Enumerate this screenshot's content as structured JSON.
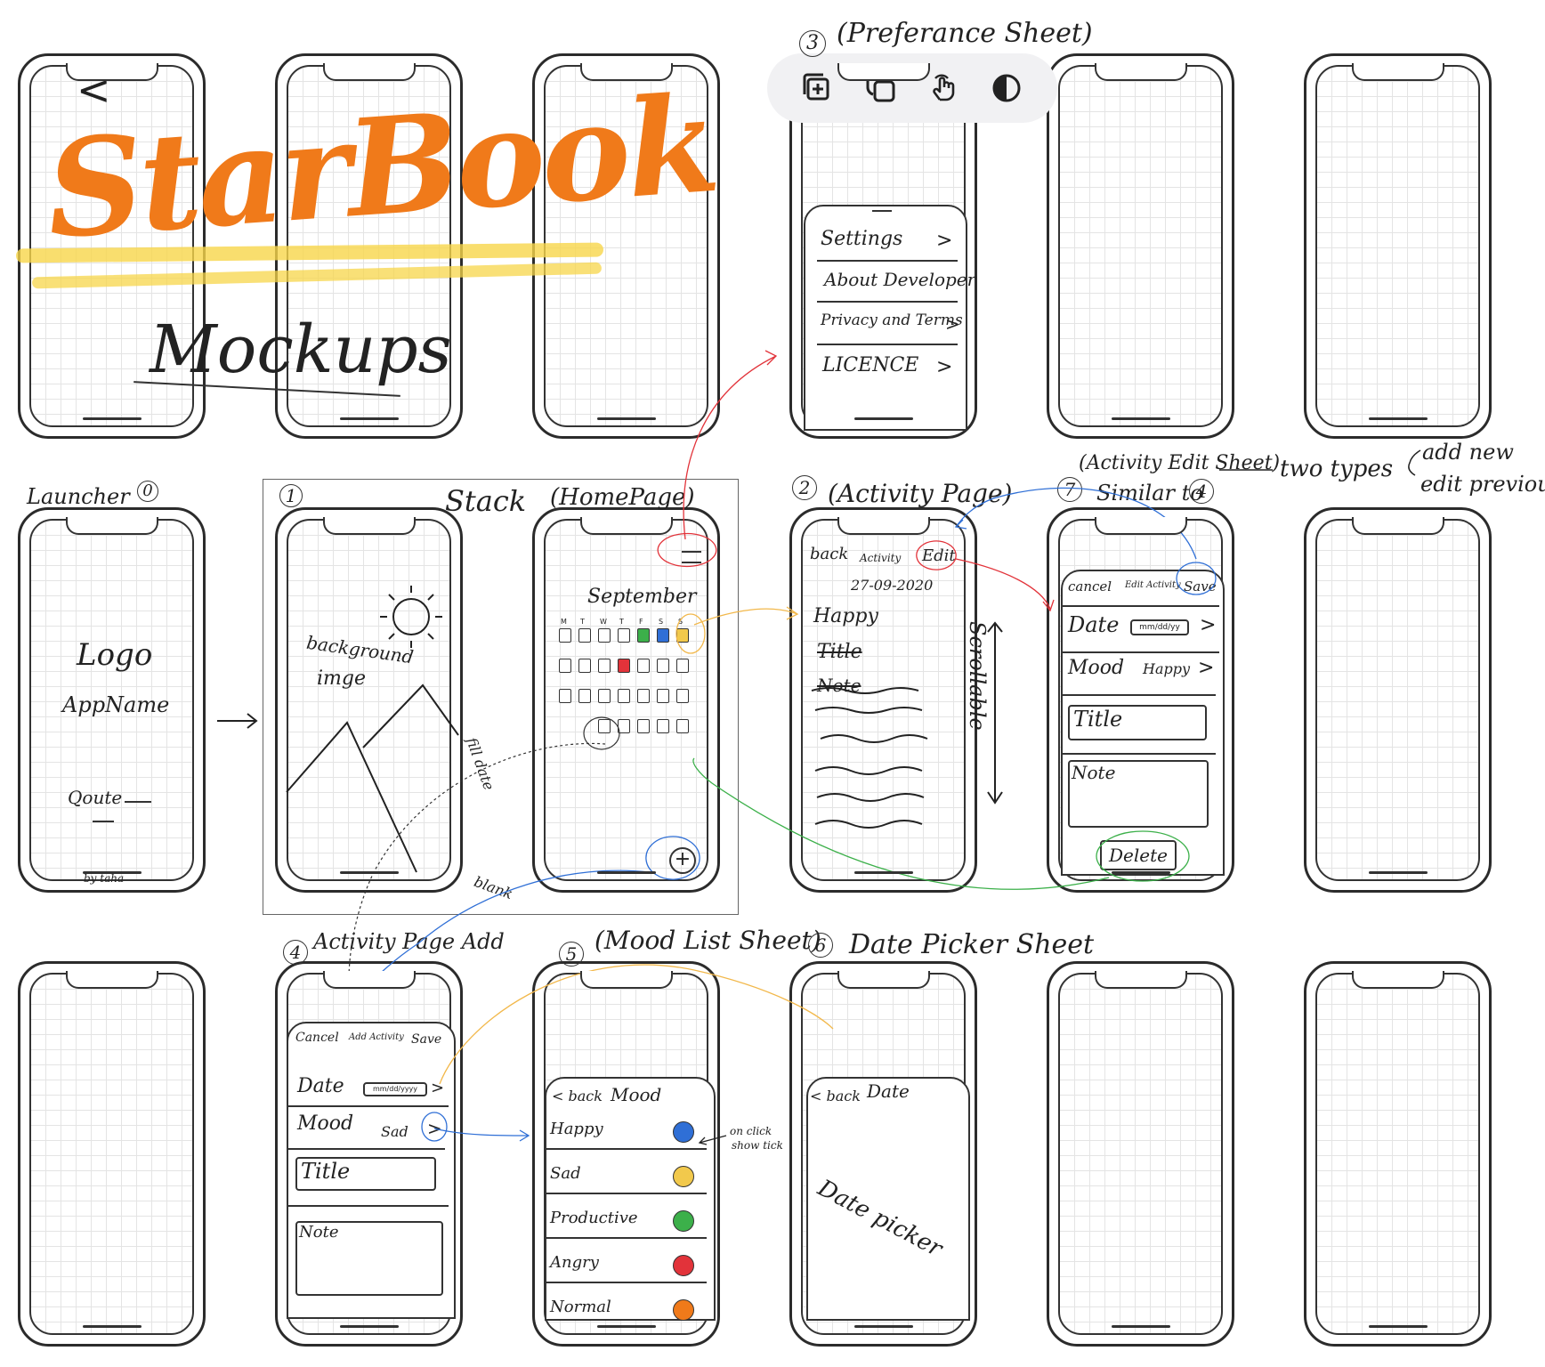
{
  "title": "StarBook",
  "subtitle": "Mockups",
  "toolbar": {
    "icons": [
      "add-layer-icon",
      "duplicate-icon",
      "touch-gesture-icon",
      "contrast-icon"
    ]
  },
  "labels": {
    "launcher": "Launcher",
    "launcher_num": "0",
    "stack_num": "1",
    "stack": "Stack",
    "homepage": "(HomePage)",
    "activity_page_num": "2",
    "activity_page": "(Activity Page)",
    "pref_num": "3",
    "pref_sheet": "(Preferance Sheet)",
    "edit_sheet": "(Activity Edit Sheet)",
    "edit_num": "7",
    "similar_to": "Similar to",
    "similar_num": "4",
    "two_types": "two types",
    "add_new": "add new",
    "edit_previous": "edit previous.",
    "add_page_num": "4",
    "add_page": "Activity Page Add",
    "mood_num": "5",
    "mood_sheet": "(Mood List Sheet)",
    "date_num": "6",
    "date_sheet": "Date Picker Sheet",
    "fill_date": "fill date",
    "blank": "blank",
    "scrollable": "Scrollable",
    "on_click": "on click",
    "show_tick": "show tick"
  },
  "launcher": {
    "logo": "Logo",
    "app_name": "AppName",
    "quote": "Qoute",
    "by": "by taha"
  },
  "stack_screen": {
    "bg_label_1": "background",
    "bg_label_2": "imge"
  },
  "home": {
    "month": "September",
    "weekdays": [
      "M",
      "T",
      "W",
      "T",
      "F",
      "S",
      "S"
    ]
  },
  "preferences": {
    "items": [
      "Settings",
      "About Developer",
      "Privacy and Terms",
      "LICENCE"
    ],
    "chevron": ">"
  },
  "activity": {
    "back": "back",
    "header": "Activity",
    "edit": "Edit",
    "date": "27-09-2020",
    "mood": "Happy",
    "title": "Title",
    "note": "Note"
  },
  "edit_sheet": {
    "cancel": "cancel",
    "header": "Edit Activity",
    "save": "Save",
    "date_label": "Date",
    "date_placeholder": "mm/dd/yy",
    "mood_label": "Mood",
    "mood_value": "Happy",
    "title_placeholder": "Title",
    "note_placeholder": "Note",
    "delete": "Delete"
  },
  "add_sheet": {
    "cancel": "Cancel",
    "header": "Add Activity",
    "save": "Save",
    "date_label": "Date",
    "date_placeholder": "mm/dd/yyyy",
    "mood_label": "Mood",
    "mood_value": "Sad",
    "title_placeholder": "Title",
    "note_placeholder": "Note"
  },
  "mood_sheet": {
    "back": "< back",
    "header": "Mood",
    "moods": [
      "Happy",
      "Sad",
      "Productive",
      "Angry",
      "Normal"
    ],
    "colors": [
      "#2f6fd6",
      "#f2c94c",
      "#3cb04a",
      "#e2333a",
      "#f07a1a"
    ]
  },
  "date_sheet": {
    "back": "< back",
    "header": "Date",
    "picker": "Date picker"
  }
}
